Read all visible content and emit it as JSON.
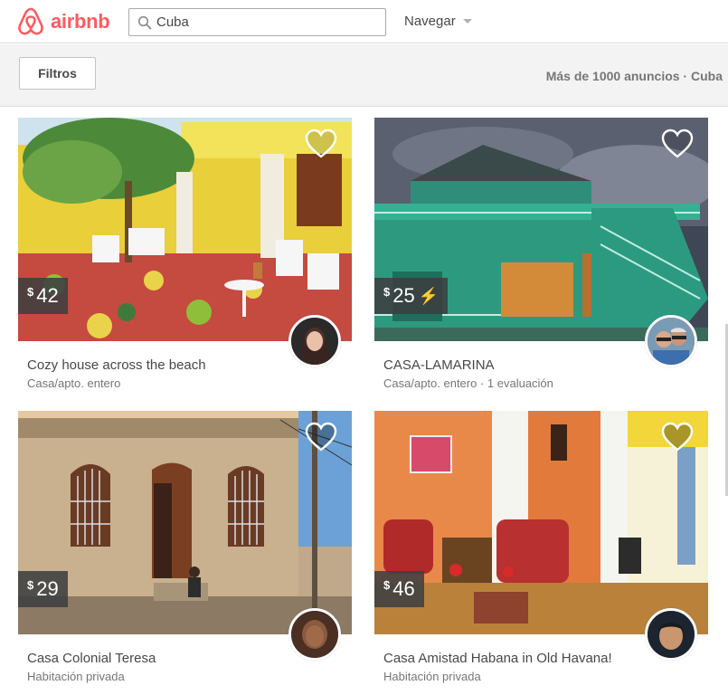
{
  "brand": {
    "name": "airbnb",
    "color": "#ff5a5f"
  },
  "search": {
    "value": "Cuba",
    "icon": "search-icon"
  },
  "nav": {
    "label": "Navegar"
  },
  "filters": {
    "button_label": "Filtros",
    "results_text": "Más de 1000 anuncios · Cuba"
  },
  "listings": [
    {
      "currency": "$",
      "price": "42",
      "instant_book": false,
      "title": "Cozy house across the beach",
      "subtitle": "Casa/apto. entero",
      "favorite_icon": "heart-outline-icon"
    },
    {
      "currency": "$",
      "price": "25",
      "instant_book": true,
      "title": "CASA-LAMARINA",
      "subtitle": "Casa/apto. entero · 1 evaluación",
      "favorite_icon": "heart-outline-icon"
    },
    {
      "currency": "$",
      "price": "29",
      "instant_book": false,
      "title": "Casa Colonial Teresa",
      "subtitle": "Habitación privada",
      "favorite_icon": "heart-outline-icon"
    },
    {
      "currency": "$",
      "price": "46",
      "instant_book": false,
      "title": "Casa Amistad Habana in Old Havana!",
      "subtitle": "Habitación privada",
      "favorite_icon": "heart-outline-icon"
    }
  ]
}
